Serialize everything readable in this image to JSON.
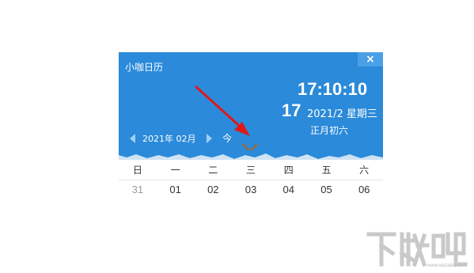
{
  "window": {
    "title": "小咖日历",
    "close_label": "×"
  },
  "clock": {
    "time": "17:10:10",
    "day": "17",
    "date_weekday": "2021/2 星期三",
    "lunar": "正月初六"
  },
  "nav": {
    "month_label": "2021年 02月",
    "today_label": "今"
  },
  "weekdays": [
    "日",
    "一",
    "二",
    "三",
    "四",
    "五",
    "六"
  ],
  "first_row": [
    "31",
    "01",
    "02",
    "03",
    "04",
    "05",
    "06"
  ],
  "colors": {
    "header_bg": "#2b8ad9",
    "annotation_arrow": "#e01818",
    "check_mark": "#9a6a3a"
  },
  "watermark": {
    "logo_text": "下载吧",
    "url": "www.xiazaiba.com"
  }
}
